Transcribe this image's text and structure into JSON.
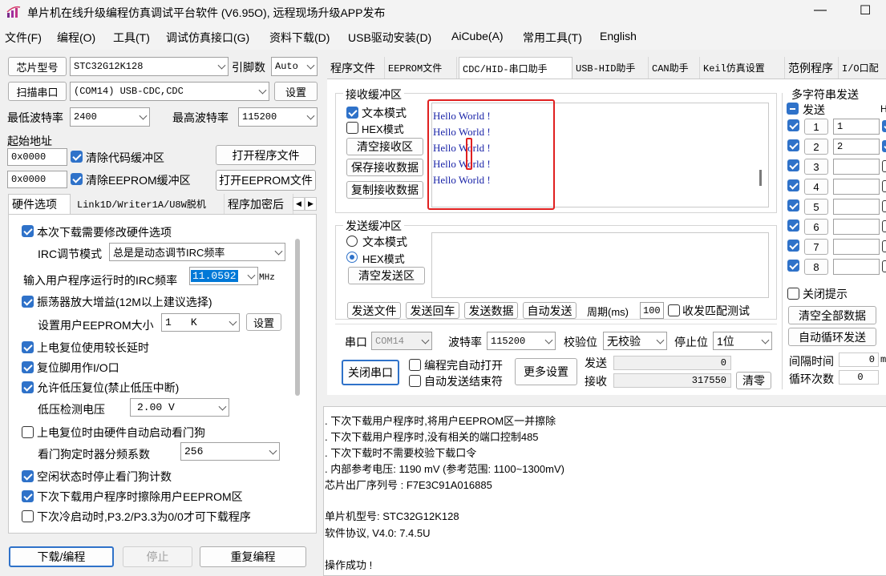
{
  "window": {
    "title": "单片机在线升级编程仿真调试平台软件 (V6.95O), 远程现场升级APP发布",
    "minimize_glyph": "—",
    "maximize_glyph": "☐"
  },
  "menu": [
    "文件(F)",
    "编程(O)",
    "工具(T)",
    "调试仿真接口(G)",
    "资料下载(D)",
    "USB驱动安装(D)",
    "AiCube(A)",
    "常用工具(T)",
    "English"
  ],
  "left": {
    "chip_model_label": "芯片型号",
    "chip_model_value": "STC32G12K128",
    "pin_count_label": "引脚数",
    "pin_count_value": "Auto",
    "scan_port_button": "扫描串口",
    "port_value": "(COM14) USB-CDC,CDC",
    "settings_button": "设置",
    "min_baud_label": "最低波特率",
    "min_baud_value": "2400",
    "max_baud_label": "最高波特率",
    "max_baud_value": "115200",
    "start_addr_label": "起始地址",
    "addr1_value": "0x0000",
    "clear_code_label": "清除代码缓冲区",
    "open_program_button": "打开程序文件",
    "addr2_value": "0x0000",
    "clear_eeprom_label": "清除EEPROM缓冲区",
    "open_eeprom_button": "打开EEPROM文件",
    "tabs": [
      "硬件选项",
      "Link1D/Writer1A/U8W脱机",
      "程序加密后"
    ],
    "tab_scroll_left": "◀",
    "tab_scroll_right": "▶",
    "hw": {
      "modify_hw_label": "本次下载需要修改硬件选项",
      "irc_mode_label": "IRC调节模式",
      "irc_mode_value": "总是是动态调节IRC频率",
      "irc_freq_label": "输入用户程序运行时的IRC频率",
      "irc_freq_value": "11.0592",
      "irc_freq_unit": "MHz",
      "osc_gain_label": "振荡器放大增益(12M以上建议选择)",
      "eeprom_size_label": "设置用户EEPROM大小",
      "eeprom_size_value": "1",
      "eeprom_size_unit": "K",
      "eeprom_settings_button": "设置",
      "long_reset_label": "上电复位使用较长延时",
      "reset_pin_label": "复位脚用作I/O口",
      "low_volt_reset_label": "允许低压复位(禁止低压中断)",
      "low_volt_label": "低压检测电压",
      "low_volt_value": "2.00 V",
      "watchdog_label": "上电复位时由硬件自动启动看门狗",
      "wdt_div_label": "看门狗定时器分频系数",
      "wdt_div_value": "256",
      "idle_wdt_label": "空闲状态时停止看门狗计数",
      "erase_eeprom_label": "下次下载用户程序时擦除用户EEPROM区",
      "cold_boot_label": "下次冷启动时,P3.2/P3.3为0/0才可下载程序"
    },
    "download_button": "下载/编程",
    "stop_button": "停止",
    "reprogram_button": "重复编程"
  },
  "right_tabs": [
    "程序文件",
    "EEPROM文件",
    "CDC/HID-串口助手",
    "USB-HID助手",
    "CAN助手",
    "Keil仿真设置",
    "范例程序",
    "I/O口配"
  ],
  "serial": {
    "rx_group": "接收缓冲区",
    "rx_text_mode": "文本模式",
    "rx_hex_mode": "HEX模式",
    "clear_rx_button": "清空接收区",
    "save_rx_button": "保存接收数据",
    "copy_rx_button": "复制接收数据",
    "rx_lines": [
      "Hello World !",
      "Hello World !",
      "Hello World !",
      "Hello World !",
      "Hello World !"
    ],
    "tx_group": "发送缓冲区",
    "tx_text_mode": "文本模式",
    "tx_hex_mode": "HEX模式",
    "clear_tx_button": "清空发送区",
    "send_file_button": "发送文件",
    "send_enter_button": "发送回车",
    "send_data_button": "发送数据",
    "auto_send_button": "自动发送",
    "period_label": "周期(ms)",
    "period_value": "100",
    "match_test_label": "收发匹配测试",
    "port_label": "串口",
    "port_value": "COM14",
    "baud_label": "波特率",
    "baud_value": "115200",
    "parity_label": "校验位",
    "parity_value": "无校验",
    "stop_label": "停止位",
    "stop_value": "1位",
    "close_port_button": "关闭串口",
    "auto_open_label": "编程完自动打开",
    "auto_end_label": "自动发送结束符",
    "more_settings_button": "更多设置",
    "send_label": "发送",
    "send_count": "0",
    "recv_label": "接收",
    "recv_count": "317550",
    "clear_zero_button": "清零"
  },
  "multi": {
    "title": "多字符串发送",
    "send_header": "发送",
    "h_header": "H",
    "rows": [
      {
        "num": "1",
        "value": "1"
      },
      {
        "num": "2",
        "value": "2"
      },
      {
        "num": "3",
        "value": ""
      },
      {
        "num": "4",
        "value": ""
      },
      {
        "num": "5",
        "value": ""
      },
      {
        "num": "6",
        "value": ""
      },
      {
        "num": "7",
        "value": ""
      },
      {
        "num": "8",
        "value": ""
      }
    ],
    "close_tip_label": "关闭提示",
    "clear_all_button": "清空全部数据",
    "auto_loop_button": "自动循环发送",
    "interval_label": "间隔时间",
    "interval_value": "0",
    "interval_unit": "m",
    "loop_count_label": "循环次数",
    "loop_count_value": "0"
  },
  "log": [
    "  . 下次下载用户程序时,将用户EEPROM区一并擦除",
    "  . 下次下载用户程序时,没有相关的端口控制485",
    "  . 下次下载时不需要校验下载口令",
    "  . 内部参考电压: 1190 mV (参考范围: 1100~1300mV)",
    "芯片出厂序列号 : F7E3C91A016885",
    "",
    "  单片机型号: STC32G12K128",
    "  软件协议, V4.0: 7.4.5U",
    "",
    "操作成功 !"
  ],
  "colors": {
    "accent": "#2f72c9",
    "highlight_red": "#e02020",
    "rx_text": "#1a24a8",
    "selection": "#0078d7"
  }
}
